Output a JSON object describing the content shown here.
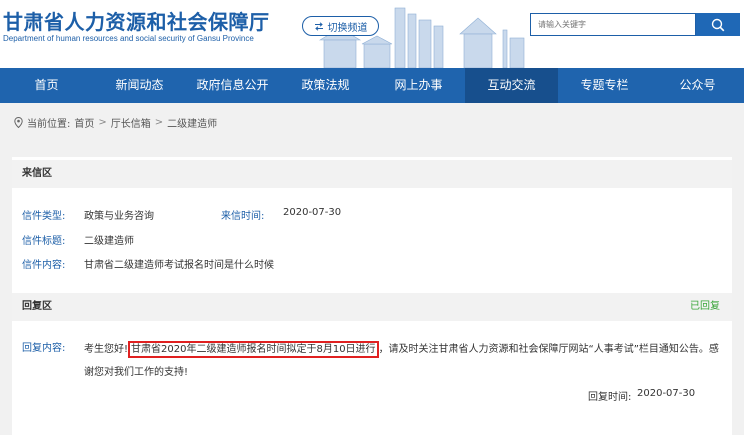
{
  "header": {
    "title": "甘肃省人力资源和社会保障厅",
    "subtitle": "Department of human resources and social security of Gansu Province",
    "switch_label": "切换频道",
    "search_placeholder": "请输入关键字"
  },
  "nav": {
    "items": [
      "首页",
      "新闻动态",
      "政府信息公开",
      "政策法规",
      "网上办事",
      "互动交流",
      "专题专栏",
      "公众号"
    ],
    "active_index": 5
  },
  "breadcrumb": {
    "prefix": "当前位置:",
    "items": [
      "首页",
      "厅长信箱",
      "二级建造师"
    ],
    "separator": ">"
  },
  "letter": {
    "section_title": "来信区",
    "type_label": "信件类型:",
    "type_value": "政策与业务咨询",
    "time_label": "来信时间:",
    "time_value": "2020-07-30",
    "subject_label": "信件标题:",
    "subject_value": "二级建造师",
    "content_label": "信件内容:",
    "content_value": "甘肃省二级建造师考试报名时间是什么时候"
  },
  "reply": {
    "section_title": "回复区",
    "status": "已回复",
    "content_label": "回复内容:",
    "text_before": "考生您好!",
    "text_highlight": "甘肃省2020年二级建造师报名时间拟定于8月10日进行",
    "text_after": "，请及时关注甘肃省人力资源和社会保障厅网站“人事考试”栏目通知公告。感谢您对我们工作的支持!",
    "time_label": "回复时间:",
    "time_value": "2020-07-30"
  },
  "colors": {
    "brand_blue": "#1f64ae",
    "highlight_red": "#e02020",
    "status_green": "#3aa53a"
  },
  "icons": {
    "switch": "swap-arrows-icon",
    "search": "search-icon",
    "location": "location-pin-icon"
  }
}
